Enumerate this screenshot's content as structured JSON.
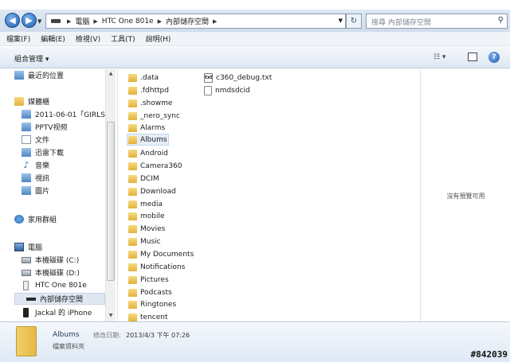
{
  "address": {
    "crumbs": [
      "電腦",
      "HTC One 801e",
      "內部儲存空間"
    ],
    "search_placeholder": "搜尋 內部儲存空間"
  },
  "menu": [
    "檔案(F)",
    "編輯(E)",
    "檢視(V)",
    "工具(T)",
    "說明(H)"
  ],
  "toolbar": {
    "organize_label": "組合管理 ▾"
  },
  "sidebar": {
    "items": [
      {
        "label": "最近的位置",
        "icon": "recent-places-icon"
      },
      {
        "label": "媒體櫃",
        "icon": "libraries-icon"
      },
      {
        "label": "2011-06-01「GIRLS'",
        "icon": "library-icon"
      },
      {
        "label": "PPTV视频",
        "icon": "library-icon"
      },
      {
        "label": "文件",
        "icon": "documents-icon"
      },
      {
        "label": "迅雷下載",
        "icon": "library-icon"
      },
      {
        "label": "音樂",
        "icon": "music-icon"
      },
      {
        "label": "視訊",
        "icon": "video-icon"
      },
      {
        "label": "圖片",
        "icon": "pictures-icon"
      },
      {
        "label": "家用群組",
        "icon": "homegroup-icon"
      },
      {
        "label": "電腦",
        "icon": "computer-icon"
      },
      {
        "label": "本機磁碟 (C:)",
        "icon": "drive-icon"
      },
      {
        "label": "本機磁碟 (D:)",
        "icon": "drive-icon"
      },
      {
        "label": "HTC One 801e",
        "icon": "phone-icon"
      },
      {
        "label": "內部儲存空間",
        "icon": "storage-icon"
      },
      {
        "label": "Jackal 的 iPhone",
        "icon": "iphone-icon"
      }
    ]
  },
  "files": {
    "col1": [
      ".data",
      ".fdhttpd",
      ".showme",
      "_nero_sync",
      "Alarms",
      "Albums",
      "Android",
      "Camera360",
      "DCIM",
      "Download",
      "media",
      "mobile",
      "Movies",
      "Music",
      "My Documents",
      "Notifications",
      "Pictures",
      "Podcasts",
      "Ringtones",
      "tencent"
    ],
    "col2": [
      "c360_debug.txt",
      "nmdsdcid"
    ],
    "txt_icon_label": "txt",
    "selected": "Albums"
  },
  "preview": {
    "message": "沒有預覽可用"
  },
  "details": {
    "name": "Albums",
    "modified_label": "修改日期:",
    "modified_value": "2013/4/3 下午 07:26",
    "type": "檔案資料夾"
  },
  "watermark": "#842039",
  "colors": {
    "accent": "#1d5fae",
    "folder": "#e6b847",
    "selection": "#dfe8f2"
  }
}
